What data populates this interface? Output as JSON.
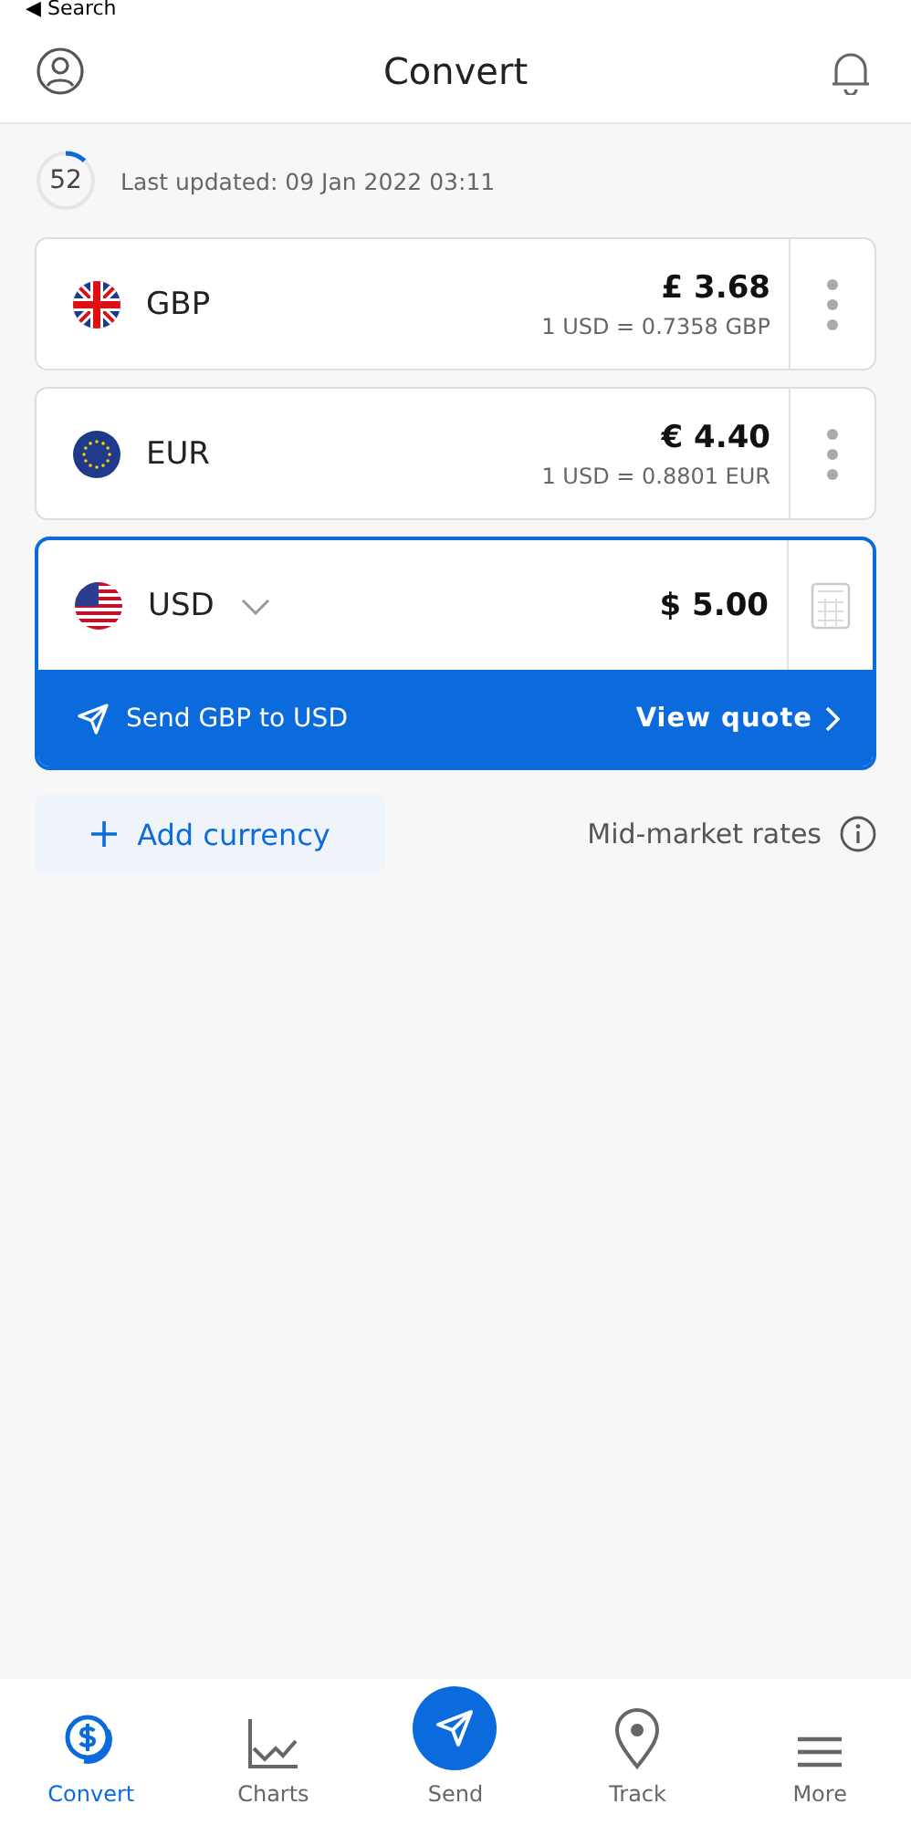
{
  "status_bar": {
    "back_label": "◀ Search"
  },
  "header": {
    "title": "Convert"
  },
  "refresh": {
    "countdown": "52",
    "level": 0.12,
    "last_updated": "Last updated: 09 Jan 2022 03:11"
  },
  "currencies": [
    {
      "kind": "rate",
      "code": "GBP",
      "flag": {
        "kind": "gb"
      },
      "amount": "£ 3.68",
      "rate": "1 USD = 0.7358 GBP",
      "selected": false
    },
    {
      "kind": "rate",
      "code": "EUR",
      "flag": {
        "kind": "eu"
      },
      "amount": "€ 4.40",
      "rate": "1 USD = 0.8801 EUR",
      "selected": false
    },
    {
      "kind": "base",
      "code": "USD",
      "flag": {
        "kind": "us"
      },
      "amount": "$ 5.00",
      "selected": true
    }
  ],
  "send_bar": {
    "label": "Send GBP to USD",
    "action": "View quote"
  },
  "add_currency": {
    "label": "Add currency"
  },
  "mid_market": {
    "label": "Mid-market rates"
  },
  "tabs": [
    {
      "kind": "convert",
      "label": "Convert",
      "selected": true
    },
    {
      "kind": "charts",
      "label": "Charts",
      "selected": false
    },
    {
      "kind": "send",
      "label": "Send",
      "selected": false
    },
    {
      "kind": "track",
      "label": "Track",
      "selected": false
    },
    {
      "kind": "more",
      "label": "More",
      "selected": false
    }
  ]
}
